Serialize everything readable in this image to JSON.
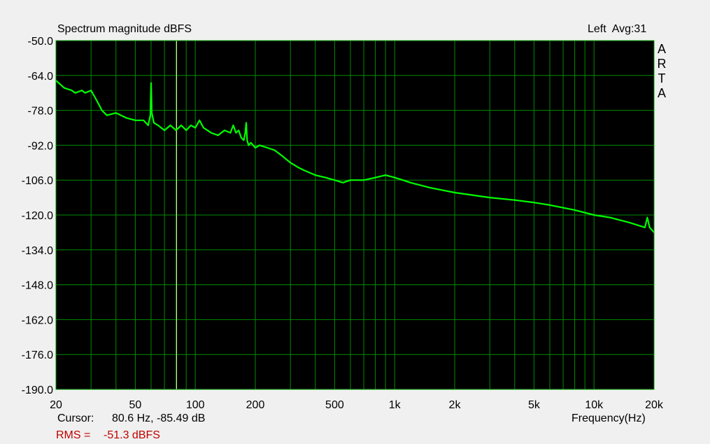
{
  "chart_data": {
    "type": "line",
    "title": "Spectrum magnitude dBFS",
    "info": "Left  Avg:31",
    "brand": [
      "A",
      "R",
      "T",
      "A"
    ],
    "xlabel": "Frequency(Hz)",
    "xscale": "log",
    "xlim": [
      20,
      20000
    ],
    "ylim": [
      -190,
      -50
    ],
    "yticks": [
      "-50.0",
      "-64.0",
      "-78.0",
      "-92.0",
      "-106.0",
      "-120.0",
      "-134.0",
      "-148.0",
      "-162.0",
      "-176.0",
      "-190.0"
    ],
    "xticks": [
      {
        "v": 20,
        "label": "20"
      },
      {
        "v": 50,
        "label": "50"
      },
      {
        "v": 100,
        "label": "100"
      },
      {
        "v": 200,
        "label": "200"
      },
      {
        "v": 500,
        "label": "500"
      },
      {
        "v": 1000,
        "label": "1k"
      },
      {
        "v": 2000,
        "label": "2k"
      },
      {
        "v": 5000,
        "label": "5k"
      },
      {
        "v": 10000,
        "label": "10k"
      },
      {
        "v": 20000,
        "label": "20k"
      }
    ],
    "grid": true,
    "cursor": {
      "label": "Cursor:",
      "text": "80.6 Hz, -85.49 dB",
      "x": 80.6
    },
    "rms": {
      "label": "RMS =",
      "text": "-51.3 dBFS"
    },
    "series": [
      {
        "color": "#00ff00",
        "x": [
          20,
          22,
          24,
          25,
          27,
          28,
          30,
          32,
          33,
          34,
          36,
          40,
          45,
          50,
          55,
          58,
          59.5,
          60,
          60.5,
          62,
          65,
          70,
          75,
          80,
          85,
          90,
          95,
          100,
          105,
          110,
          115,
          120,
          130,
          140,
          150,
          155,
          160,
          165,
          170,
          175,
          178,
          180,
          182,
          185,
          190,
          200,
          210,
          230,
          250,
          270,
          300,
          330,
          350,
          400,
          450,
          500,
          550,
          600,
          700,
          800,
          900,
          1000,
          1100,
          1200,
          1500,
          2000,
          3000,
          4000,
          5000,
          6000,
          8000,
          10000,
          12000,
          15000,
          18000,
          18500,
          19000,
          20000
        ],
        "y": [
          -66,
          -69,
          -70,
          -71,
          -70,
          -71,
          -70,
          -74,
          -76,
          -78,
          -80,
          -79,
          -81,
          -82,
          -82,
          -84,
          -80,
          -67,
          -79,
          -83,
          -84,
          -86,
          -84,
          -86,
          -84,
          -86,
          -84,
          -85,
          -82,
          -85,
          -86,
          -87,
          -88,
          -86,
          -87,
          -84,
          -87,
          -86,
          -89,
          -90,
          -87,
          -83,
          -90,
          -92,
          -91,
          -93,
          -92,
          -93,
          -94,
          -96,
          -99,
          -101,
          -102,
          -104,
          -105,
          -106,
          -107,
          -106,
          -106,
          -105,
          -104,
          -105,
          -106,
          -107,
          -109,
          -111,
          -113,
          -114,
          -115,
          -116,
          -118,
          -120,
          -121,
          -123,
          -125,
          -121,
          -125,
          -127
        ]
      }
    ]
  }
}
